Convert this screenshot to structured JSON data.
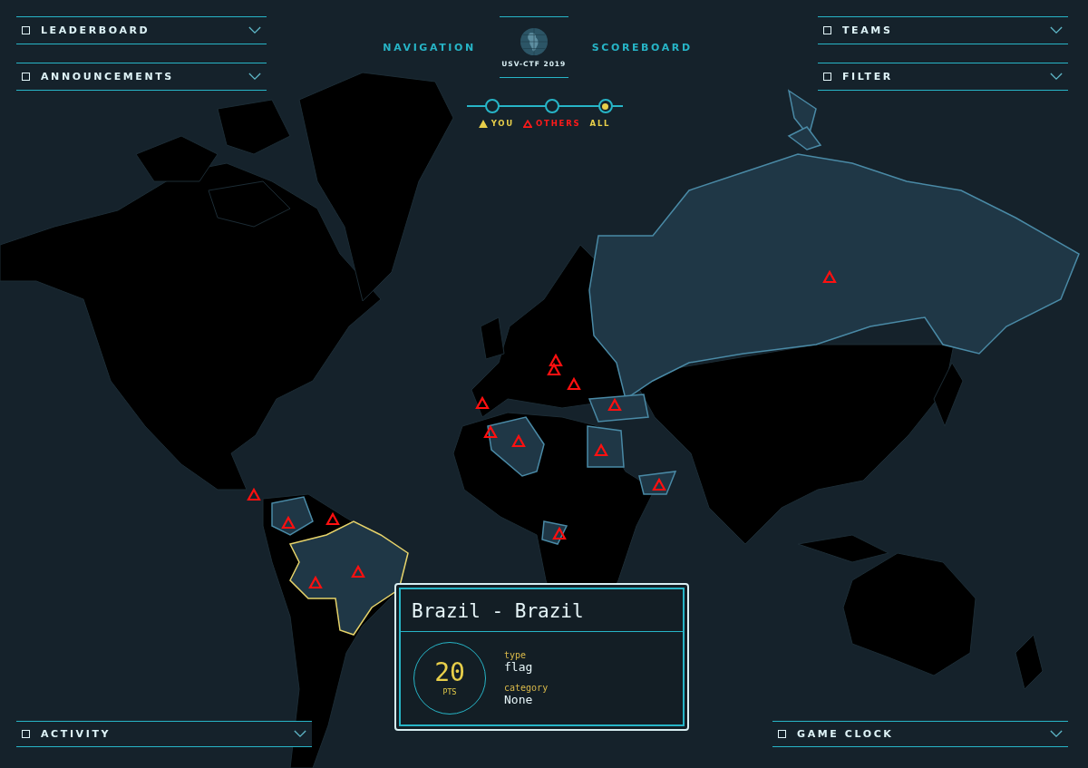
{
  "top_left_panels": [
    {
      "label": "LEADERBOARD",
      "expanded": false
    },
    {
      "label": "ANNOUNCEMENTS",
      "expanded": false
    }
  ],
  "top_right_panels": [
    {
      "label": "TEAMS",
      "expanded": false
    },
    {
      "label": "FILTER",
      "expanded": false
    }
  ],
  "header": {
    "nav_link": "NAVIGATION",
    "title": "USV-CTF 2019",
    "score_link": "SCOREBOARD"
  },
  "view_filter": [
    {
      "label": "YOU",
      "kind": "you",
      "selected": false,
      "color": "#e8cf4a"
    },
    {
      "label": "OTHERS",
      "kind": "others",
      "selected": false,
      "color": "#ff1a1a"
    },
    {
      "label": "ALL",
      "kind": "all",
      "selected": true,
      "color": "#e8cf4a"
    }
  ],
  "popup": {
    "title": "Brazil - Brazil",
    "points": "20",
    "points_unit": "PTS",
    "fields": [
      {
        "label": "type",
        "value": "flag"
      },
      {
        "label": "category",
        "value": "None"
      }
    ]
  },
  "bottom_left_panel": {
    "label": "ACTIVITY",
    "expanded": false
  },
  "bottom_right_panel": {
    "label": "GAME CLOCK",
    "expanded": false
  }
}
